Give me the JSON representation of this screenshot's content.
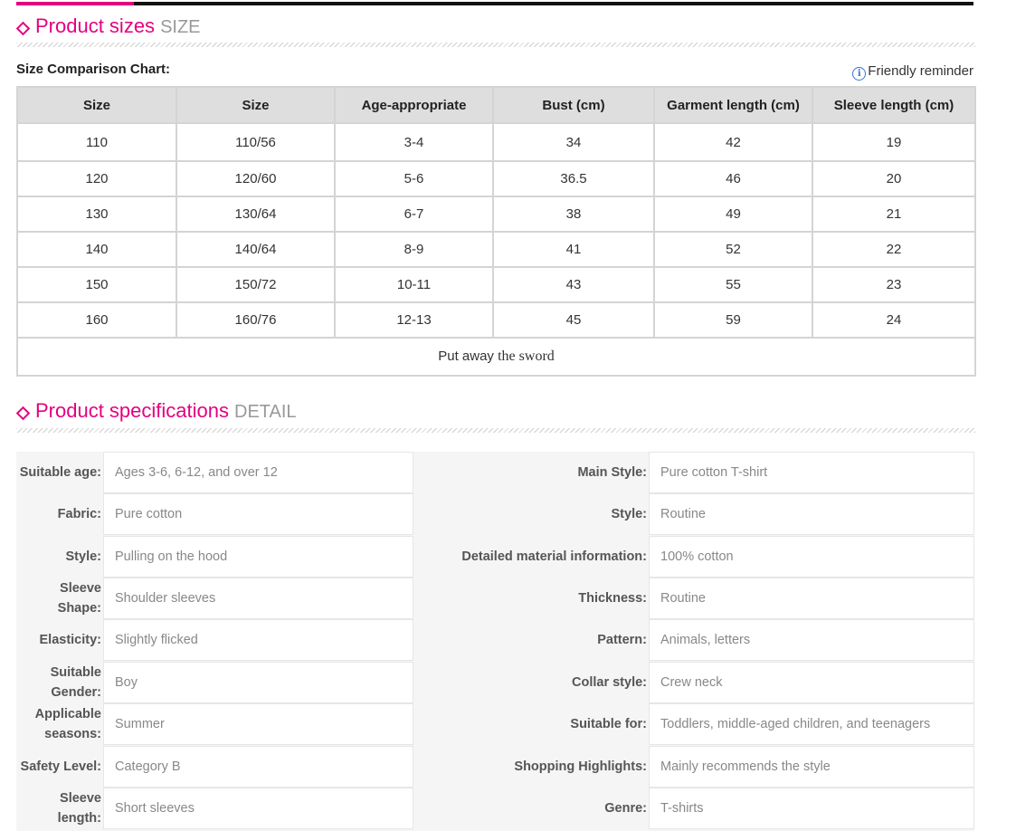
{
  "size_section": {
    "title": "Product sizes",
    "subtitle": "SIZE",
    "chart_label": "Size Comparison Chart:",
    "reminder": "Friendly reminder",
    "info_glyph": "i",
    "headers": [
      "Size",
      "Size",
      "Age-appropriate",
      "Bust (cm)",
      "Garment length (cm)",
      "Sleeve length (cm)"
    ],
    "rows": [
      [
        "110",
        "110/56",
        "3-4",
        "34",
        "42",
        "19"
      ],
      [
        "120",
        "120/60",
        "5-6",
        "36.5",
        "46",
        "20"
      ],
      [
        "130",
        "130/64",
        "6-7",
        "38",
        "49",
        "21"
      ],
      [
        "140",
        "140/64",
        "8-9",
        "41",
        "52",
        "22"
      ],
      [
        "150",
        "150/72",
        "10-11",
        "43",
        "55",
        "23"
      ],
      [
        "160",
        "160/76",
        "12-13",
        "45",
        "59",
        "24"
      ]
    ],
    "footer": {
      "part1": "Put away",
      "part2": "the  sword"
    }
  },
  "spec_section": {
    "title": "Product specifications",
    "subtitle": "DETAIL",
    "rows": [
      {
        "l1": "Suitable age:",
        "v1": "Ages 3-6, 6-12, and over 12",
        "l2": "Main Style:",
        "v2": "Pure cotton T-shirt"
      },
      {
        "l1": "Fabric:",
        "v1": "Pure cotton",
        "l2": "Style:",
        "v2": "Routine"
      },
      {
        "l1": "Style:",
        "v1": "Pulling on the hood",
        "l2": "Detailed material information:",
        "v2": "100% cotton"
      },
      {
        "l1": "Sleeve Shape:",
        "v1": "Shoulder sleeves",
        "l2": "Thickness:",
        "v2": "Routine"
      },
      {
        "l1": "Elasticity:",
        "v1": "Slightly flicked",
        "l2": "Pattern:",
        "v2": "Animals, letters"
      },
      {
        "l1": "Suitable Gender:",
        "v1": "Boy",
        "l2": "Collar style:",
        "v2": "Crew neck"
      },
      {
        "l1": "Applicable seasons:",
        "v1": "Summer",
        "l2": "Suitable for:",
        "v2": "Toddlers, middle-aged children, and teenagers"
      },
      {
        "l1": "Safety Level:",
        "v1": "Category B",
        "l2": "Shopping Highlights:",
        "v2": "Mainly recommends the style"
      },
      {
        "l1": "Sleeve length:",
        "v1": "Short sleeves",
        "l2": "Genre:",
        "v2": "T-shirts"
      }
    ]
  },
  "colors": {
    "accent": "#e4007f",
    "muted": "#999999",
    "info": "#3a73d8"
  }
}
